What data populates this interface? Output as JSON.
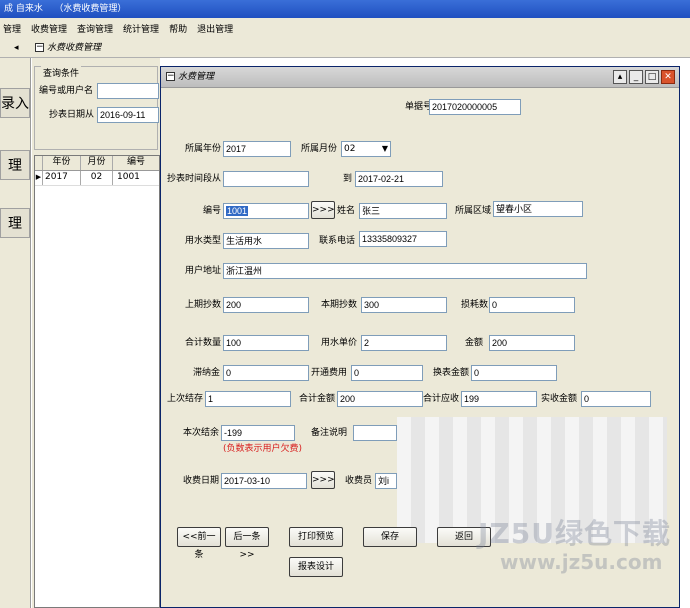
{
  "app": {
    "title_fragment": "成  自来水",
    "window_fragment": "（水费收费管理）"
  },
  "menubar": [
    "管理",
    "收费管理",
    "查询管理",
    "统计管理",
    "帮助",
    "退出管理"
  ],
  "leftnav": [
    "录入",
    "理",
    "理"
  ],
  "mdi": {
    "title": "水费收费管理"
  },
  "query": {
    "legend": "查询条件",
    "id_label": "编号或用户名",
    "id_value": "",
    "date_label": "抄表日期从",
    "date_value": "2016-09-11"
  },
  "grid": {
    "headers": [
      "年份",
      "月份",
      "编号"
    ],
    "rows": [
      [
        "2017",
        "02",
        "1001"
      ]
    ]
  },
  "window": {
    "title": "水费管理",
    "receipt_label": "单据号",
    "receipt_value": "2017020000005",
    "year_label": "所属年份",
    "year_value": "2017",
    "month_label": "所属月份",
    "month_value": "02",
    "period_from_label": "抄表时间段从",
    "period_from_value": "",
    "period_to_label": "到",
    "period_to_value": "2017-02-21",
    "code_label": "编号",
    "code_value": "1001",
    "lookup_label": ">>>",
    "name_label": "姓名",
    "name_value": "张三",
    "area_label": "所属区域",
    "area_value": "望春小区",
    "type_label": "用水类型",
    "type_value": "生活用水",
    "phone_label": "联系电话",
    "phone_value": "13335809327",
    "address_label": "用户地址",
    "address_value": "浙江温州",
    "prev_label": "上期抄数",
    "prev_value": "200",
    "curr_label": "本期抄数",
    "curr_value": "300",
    "loss_label": "损耗数",
    "loss_value": "0",
    "qty_label": "合计数量",
    "qty_value": "100",
    "price_label": "用水单价",
    "price_value": "2",
    "amount_label": "金额",
    "amount_value": "200",
    "late_label": "滞纳金",
    "late_value": "0",
    "open_label": "开通费用",
    "open_value": "0",
    "meter_label": "换表金额",
    "meter_value": "0",
    "last_balance_label": "上次结存",
    "last_balance_value": "1",
    "total_label": "合计金额",
    "total_value": "200",
    "due_label": "合计应收",
    "due_value": "199",
    "paid_label": "实收金额",
    "paid_value": "0",
    "balance_label": "本次结余",
    "balance_value": "-199",
    "balance_note": "(负数表示用户欠费)",
    "remark_label": "备注说明",
    "remark_value": "",
    "paydate_label": "收费日期",
    "paydate_value": "2017-03-10",
    "paydate_lookup": ">>>",
    "collector_label": "收费员",
    "collector_value": "刘i"
  },
  "buttons": {
    "prev": "<<前一条",
    "next": "后一条>>",
    "print": "打印预览",
    "save": "保存",
    "back": "返回",
    "design": "报表设计"
  },
  "watermark": {
    "line1": "JZ5U绿色下载",
    "line2": "www.jz5u.com"
  }
}
